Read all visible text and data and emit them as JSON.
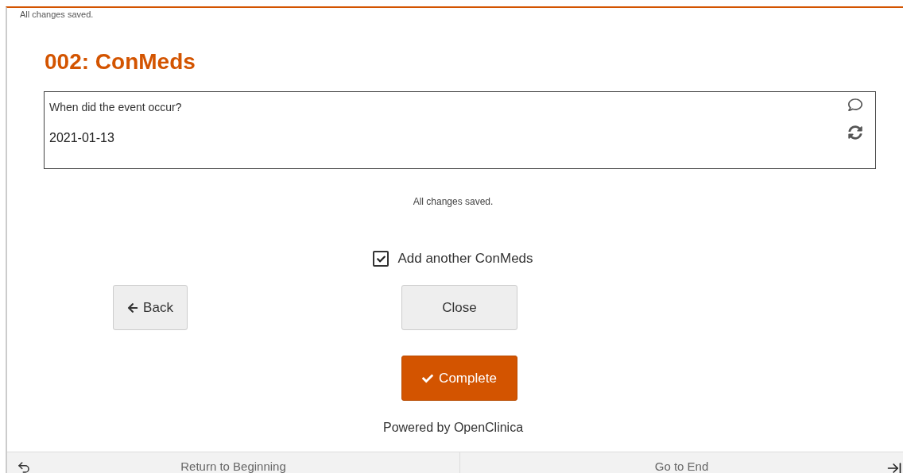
{
  "top_status": "All changes saved.",
  "title": "002: ConMeds",
  "question": {
    "label": "When did the event occur?",
    "value": "2021-01-13"
  },
  "save_status": "All changes saved.",
  "add_another": {
    "label": "Add another ConMeds",
    "checked": true
  },
  "buttons": {
    "back": "Back",
    "close": "Close",
    "complete": "Complete"
  },
  "footer": "Powered by OpenClinica",
  "bottom_nav": [
    "Return to Beginning",
    "Go to End"
  ]
}
